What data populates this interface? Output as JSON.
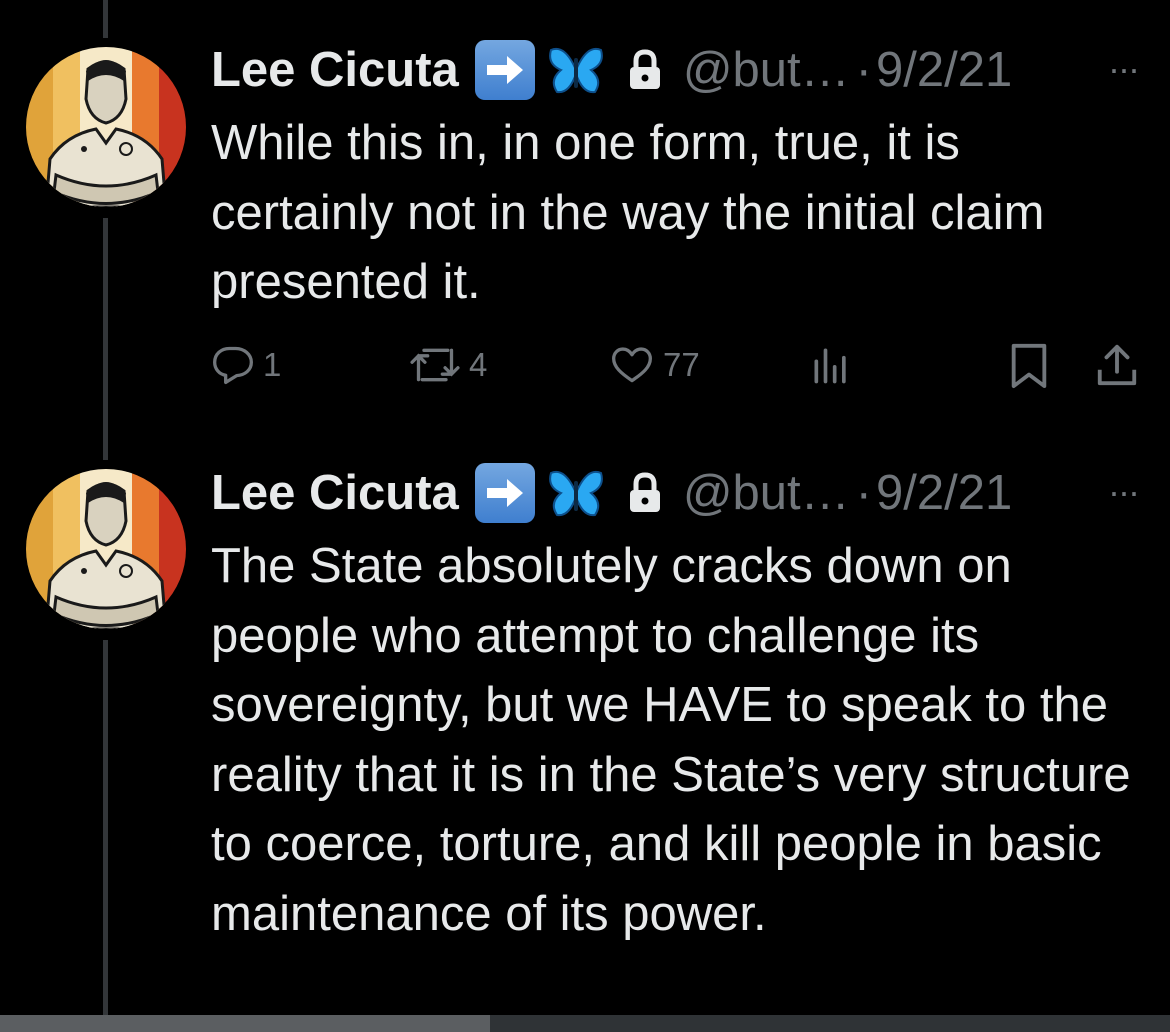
{
  "tweets": [
    {
      "author_name": "Lee Cicuta",
      "handle": "@but…",
      "separator": "·",
      "date": "9/2/21",
      "more": "···",
      "text": "While this in, in one form, true, it is certainly not in the way the initial claim presented it.",
      "replies": "1",
      "retweets": "4",
      "likes": "77"
    },
    {
      "author_name": "Lee Cicuta",
      "handle": "@but…",
      "separator": "·",
      "date": "9/2/21",
      "more": "···",
      "text": "The State absolutely cracks down on people who attempt to challenge its sovereignty, but we HAVE to speak to the reality that it is in the State’s very structure to coerce, torture, and kill people in basic maintenance of its power."
    }
  ],
  "icons": [
    "arrow-right-emoji",
    "butterfly-emoji",
    "lock-icon",
    "reply-icon",
    "retweet-icon",
    "like-icon",
    "views-icon",
    "bookmark-icon",
    "share-icon"
  ],
  "colors": {
    "background": "#000000",
    "text": "#e7e9ea",
    "muted": "#71767b",
    "arrow_emoji": "#4a8bd6",
    "butterfly": "#2aa8f2"
  }
}
